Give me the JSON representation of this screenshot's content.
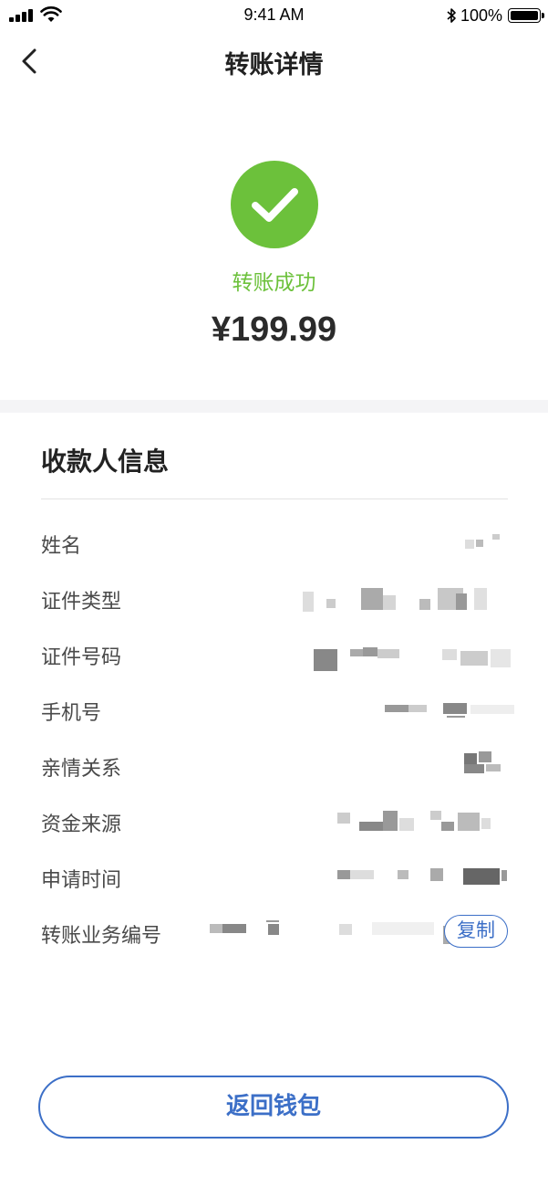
{
  "status_bar": {
    "time": "9:41 AM",
    "battery_percent": "100%",
    "icons": [
      "signal-icon",
      "wifi-icon",
      "bluetooth-icon",
      "battery-icon"
    ]
  },
  "nav": {
    "title": "转账详情",
    "back_icon": "chevron-left-icon"
  },
  "result": {
    "icon": "checkmark-icon",
    "status_text": "转账成功",
    "amount": "¥199.99"
  },
  "payee_section": {
    "title": "收款人信息",
    "rows": [
      {
        "label": "姓名",
        "value": ""
      },
      {
        "label": "证件类型",
        "value": ""
      },
      {
        "label": "证件号码",
        "value": ""
      },
      {
        "label": "手机号",
        "value": ""
      },
      {
        "label": "亲情关系",
        "value": ""
      },
      {
        "label": "资金来源",
        "value": ""
      },
      {
        "label": "申请时间",
        "value": ""
      },
      {
        "label": "转账业务编号",
        "value": ""
      }
    ],
    "copy_label": "复制"
  },
  "footer": {
    "return_label": "返回钱包"
  },
  "colors": {
    "success_green": "#6cc13b",
    "accent_blue": "#3c6fc7",
    "divider_gray": "#f4f4f6"
  }
}
